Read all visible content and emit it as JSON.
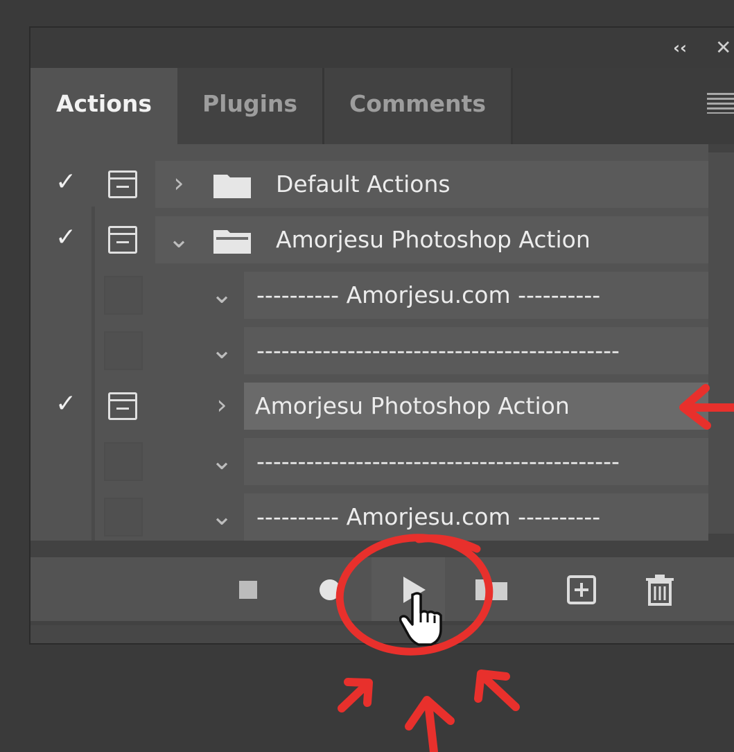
{
  "titlebar": {
    "collapse_glyph": "‹‹",
    "close_glyph": "✕"
  },
  "tabs": [
    {
      "label": "Actions",
      "active": true
    },
    {
      "label": "Plugins",
      "active": false
    },
    {
      "label": "Comments",
      "active": false
    }
  ],
  "actions": [
    {
      "label": "Default Actions",
      "checked": true,
      "dialog": true,
      "chevron": "›",
      "folder": "closed"
    },
    {
      "label": "Amorjesu Photoshop Action",
      "checked": true,
      "dialog": true,
      "chevron": "⌄",
      "folder": "open"
    },
    {
      "label": "---------- Amorjesu.com ----------",
      "checked": false,
      "dialog": false,
      "chevron": "⌄"
    },
    {
      "label": "--------------------------------------------",
      "checked": false,
      "dialog": false,
      "chevron": "⌄"
    },
    {
      "label": "Amorjesu Photoshop Action",
      "checked": true,
      "dialog": true,
      "chevron": "›",
      "selected": true
    },
    {
      "label": "--------------------------------------------",
      "checked": false,
      "dialog": false,
      "chevron": "⌄"
    },
    {
      "label": "---------- Amorjesu.com ----------",
      "checked": false,
      "dialog": false,
      "chevron": "⌄"
    }
  ],
  "toolbar": {
    "buttons": [
      "stop-icon",
      "record-icon",
      "play-icon",
      "folder-icon",
      "new-action-icon",
      "trash-icon"
    ]
  },
  "colors": {
    "annotation": "#e8302c",
    "panel_bg": "#535353",
    "selected_row": "#6a6a6a"
  }
}
